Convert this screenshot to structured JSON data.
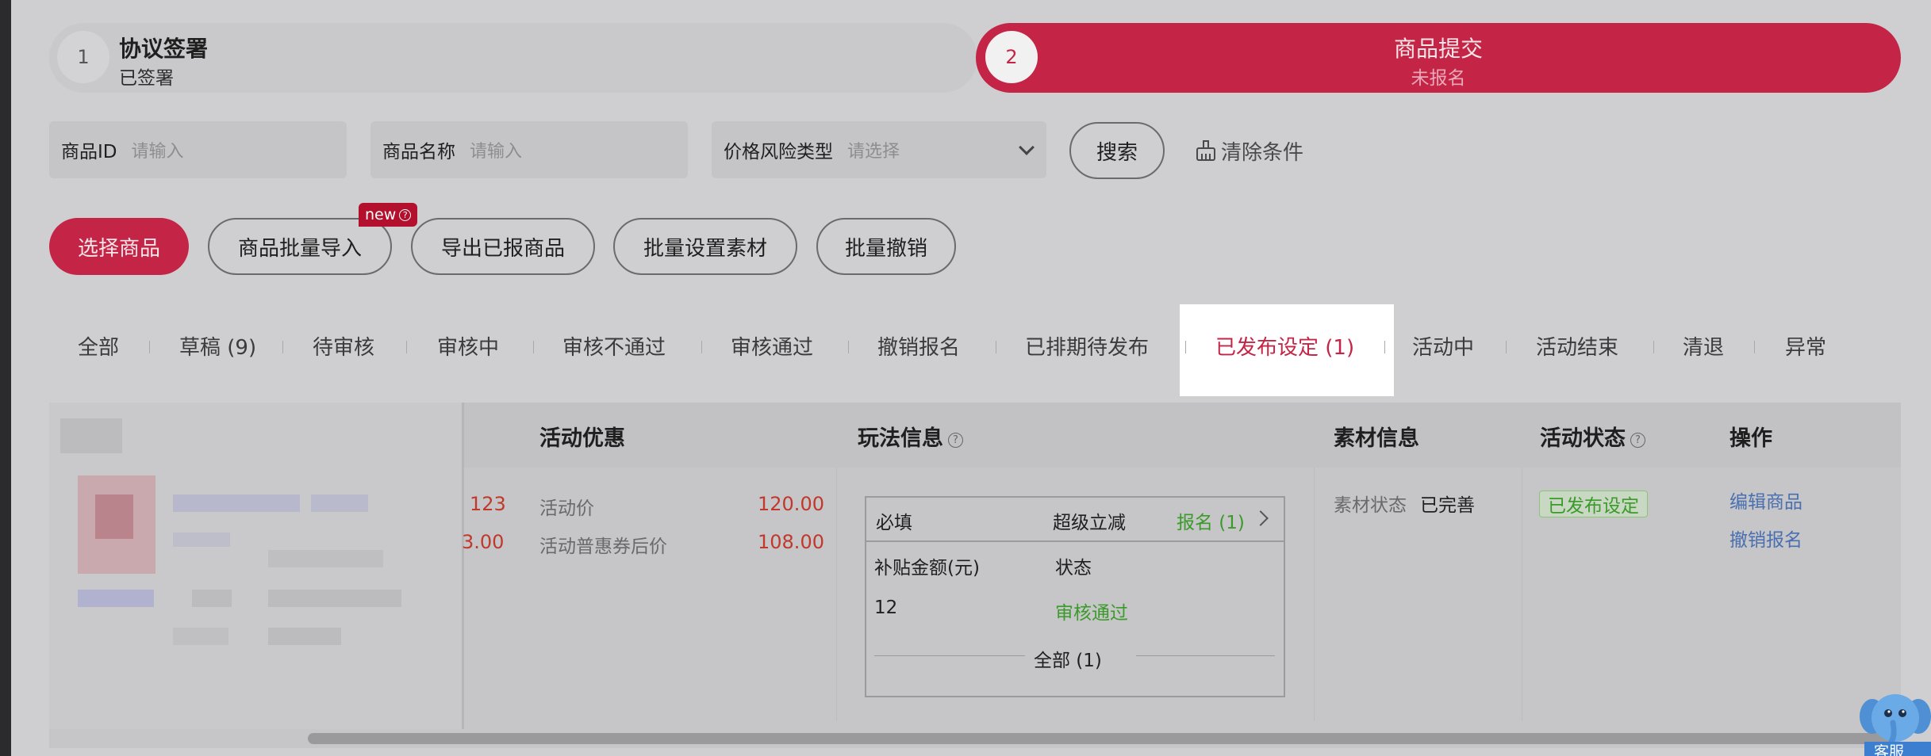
{
  "steps": [
    {
      "num": "1",
      "title": "协议签署",
      "status": "已签署"
    },
    {
      "num": "2",
      "title": "商品提交",
      "status": "未报名"
    }
  ],
  "filters": {
    "product_id": {
      "label": "商品ID",
      "placeholder": "请输入"
    },
    "product_name": {
      "label": "商品名称",
      "placeholder": "请输入"
    },
    "price_risk": {
      "label": "价格风险类型",
      "placeholder": "请选择"
    },
    "search_label": "搜索",
    "clear_label": "清除条件"
  },
  "actions": {
    "select_goods": "选择商品",
    "batch_import": "商品批量导入",
    "new_badge": "new",
    "export": "导出已报商品",
    "batch_material": "批量设置素材",
    "batch_cancel": "批量撤销"
  },
  "tabs": [
    "全部",
    "草稿 (9)",
    "待审核",
    "审核中",
    "审核不通过",
    "审核通过",
    "撤销报名",
    "已排期待发布",
    "已发布设定 (1)",
    "活动中",
    "活动结束",
    "清退",
    "异常"
  ],
  "active_tab": "已发布设定 (1)",
  "table": {
    "headers": {
      "discount": "活动优惠",
      "play": "玩法信息",
      "material": "素材信息",
      "status": "活动状态",
      "ops": "操作"
    },
    "row": {
      "price_partial_1": "123",
      "price_partial_2": "3.00",
      "activity_price_label": "活动价",
      "activity_price_value": "120.00",
      "coupon_price_label": "活动普惠券后价",
      "coupon_price_value": "108.00",
      "play": {
        "required": "必填",
        "name": "超级立减",
        "signup": "报名 (1)",
        "col_subsidy": "补贴金额(元)",
        "col_status": "状态",
        "subsidy_value": "12",
        "status_value": "审核通过",
        "all_label": "全部 (1)"
      },
      "material_label": "素材状态",
      "material_value": "已完善",
      "status_tag": "已发布设定",
      "op_edit": "编辑商品",
      "op_cancel": "撤销报名"
    }
  },
  "mascot_label": "客服",
  "colors": {
    "brand": "#c42546",
    "success": "#3a9a2a",
    "link": "#4a6fb0",
    "price": "#c0392b"
  }
}
